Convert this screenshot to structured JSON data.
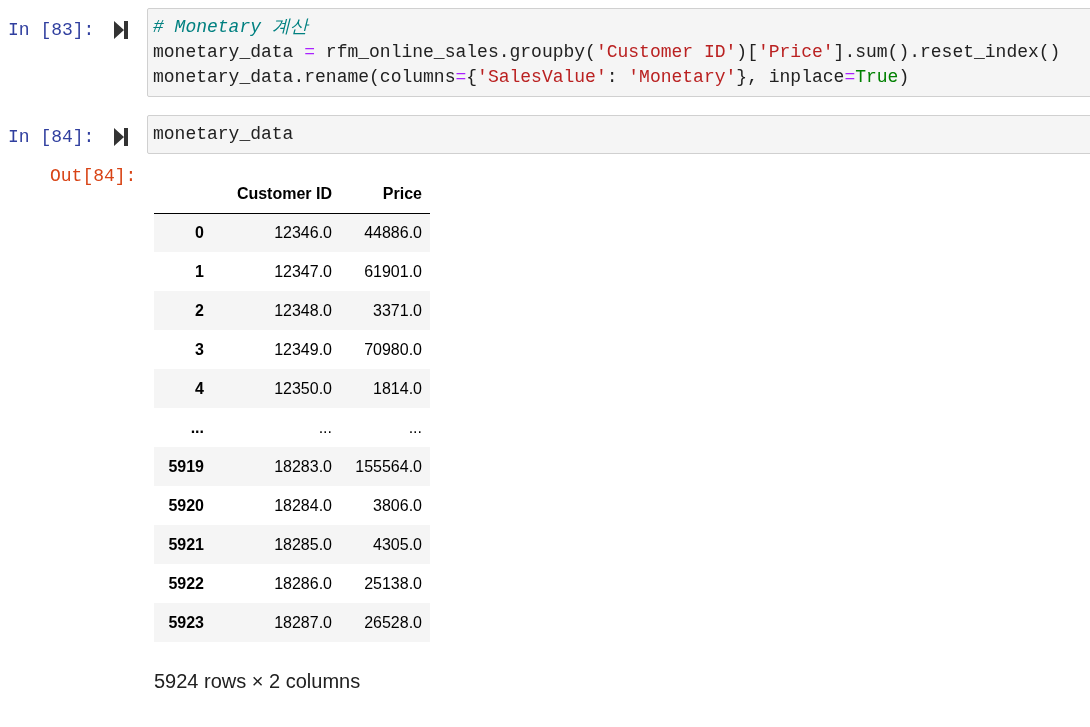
{
  "cells": [
    {
      "prompt": "In [83]:",
      "lines": [
        [
          {
            "kind": "comment",
            "text": "# Monetary 계산"
          }
        ],
        [
          {
            "kind": "plain",
            "text": "monetary_data "
          },
          {
            "kind": "op",
            "text": "="
          },
          {
            "kind": "plain",
            "text": " rfm_online_sales.groupby("
          },
          {
            "kind": "string",
            "text": "'Customer ID'"
          },
          {
            "kind": "plain",
            "text": ")["
          },
          {
            "kind": "string",
            "text": "'Price'"
          },
          {
            "kind": "plain",
            "text": "].sum().reset_index()"
          }
        ],
        [
          {
            "kind": "plain",
            "text": "monetary_data.rename(columns"
          },
          {
            "kind": "op",
            "text": "="
          },
          {
            "kind": "plain",
            "text": "{"
          },
          {
            "kind": "string",
            "text": "'SalesValue'"
          },
          {
            "kind": "plain",
            "text": ": "
          },
          {
            "kind": "string",
            "text": "'Monetary'"
          },
          {
            "kind": "plain",
            "text": "}, inplace"
          },
          {
            "kind": "op",
            "text": "="
          },
          {
            "kind": "keyword",
            "text": "True"
          },
          {
            "kind": "plain",
            "text": ")"
          }
        ]
      ]
    },
    {
      "prompt": "In [84]:",
      "lines": [
        [
          {
            "kind": "plain",
            "text": "monetary_data"
          }
        ]
      ]
    }
  ],
  "output": {
    "prompt": "Out[84]:",
    "table": {
      "columns": [
        "",
        "Customer ID",
        "Price"
      ],
      "rows": [
        [
          "0",
          "12346.0",
          "44886.0"
        ],
        [
          "1",
          "12347.0",
          "61901.0"
        ],
        [
          "2",
          "12348.0",
          "3371.0"
        ],
        [
          "3",
          "12349.0",
          "70980.0"
        ],
        [
          "4",
          "12350.0",
          "1814.0"
        ],
        [
          "...",
          "...",
          "..."
        ],
        [
          "5919",
          "18283.0",
          "155564.0"
        ],
        [
          "5920",
          "18284.0",
          "3806.0"
        ],
        [
          "5921",
          "18285.0",
          "4305.0"
        ],
        [
          "5922",
          "18286.0",
          "25138.0"
        ],
        [
          "5923",
          "18287.0",
          "26528.0"
        ]
      ]
    },
    "footer": "5924 rows × 2 columns"
  }
}
